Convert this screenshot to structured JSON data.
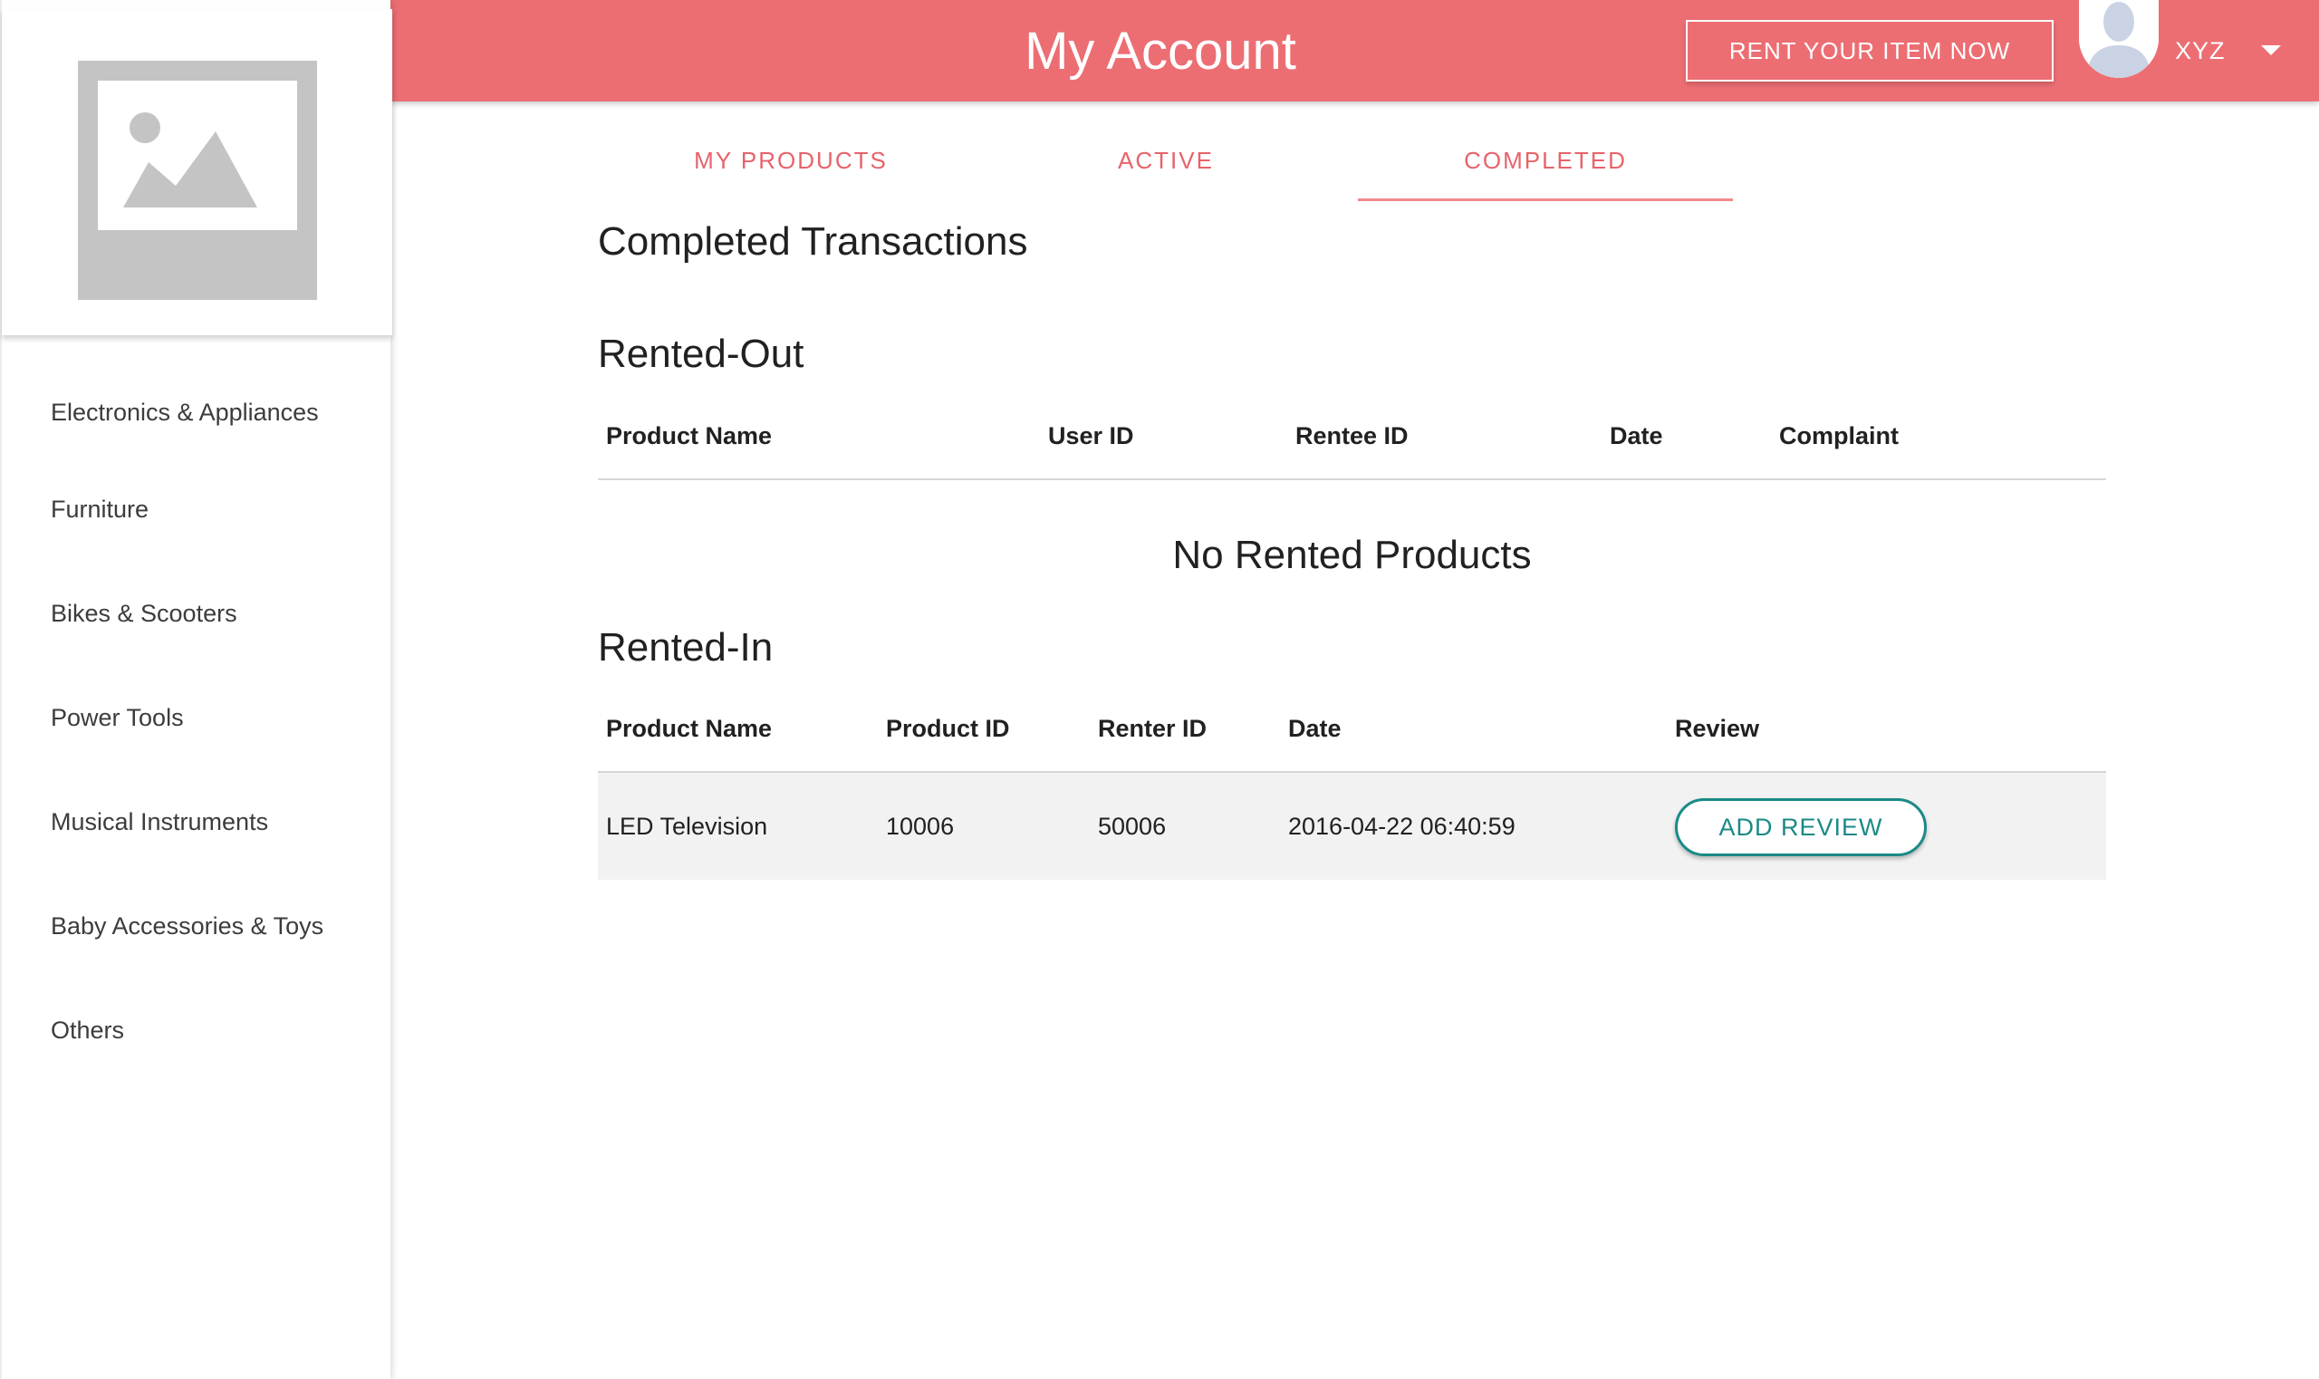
{
  "header": {
    "title": "My Account",
    "rent_button": "RENT YOUR ITEM NOW",
    "username": "XYZ",
    "brand_color": "#ec6e73"
  },
  "sidebar": {
    "categories": [
      "Electronics & Appliances",
      "Furniture",
      "Bikes & Scooters",
      "Power Tools",
      "Musical Instruments",
      "Baby Accessories & Toys",
      "Others"
    ]
  },
  "tabs": [
    {
      "label": "MY PRODUCTS",
      "active": false
    },
    {
      "label": "ACTIVE",
      "active": false
    },
    {
      "label": "COMPLETED",
      "active": true
    }
  ],
  "main": {
    "title": "Completed Transactions",
    "rented_out": {
      "title": "Rented-Out",
      "columns": [
        "Product Name",
        "User ID",
        "Rentee ID",
        "Date",
        "Complaint"
      ],
      "empty_message": "No Rented Products"
    },
    "rented_in": {
      "title": "Rented-In",
      "columns": [
        "Product Name",
        "Product ID",
        "Renter ID",
        "Date",
        "Review"
      ],
      "rows": [
        {
          "product_name": "LED Television",
          "product_id": "10006",
          "renter_id": "50006",
          "date": "2016-04-22 06:40:59",
          "action": "ADD REVIEW"
        }
      ]
    }
  }
}
